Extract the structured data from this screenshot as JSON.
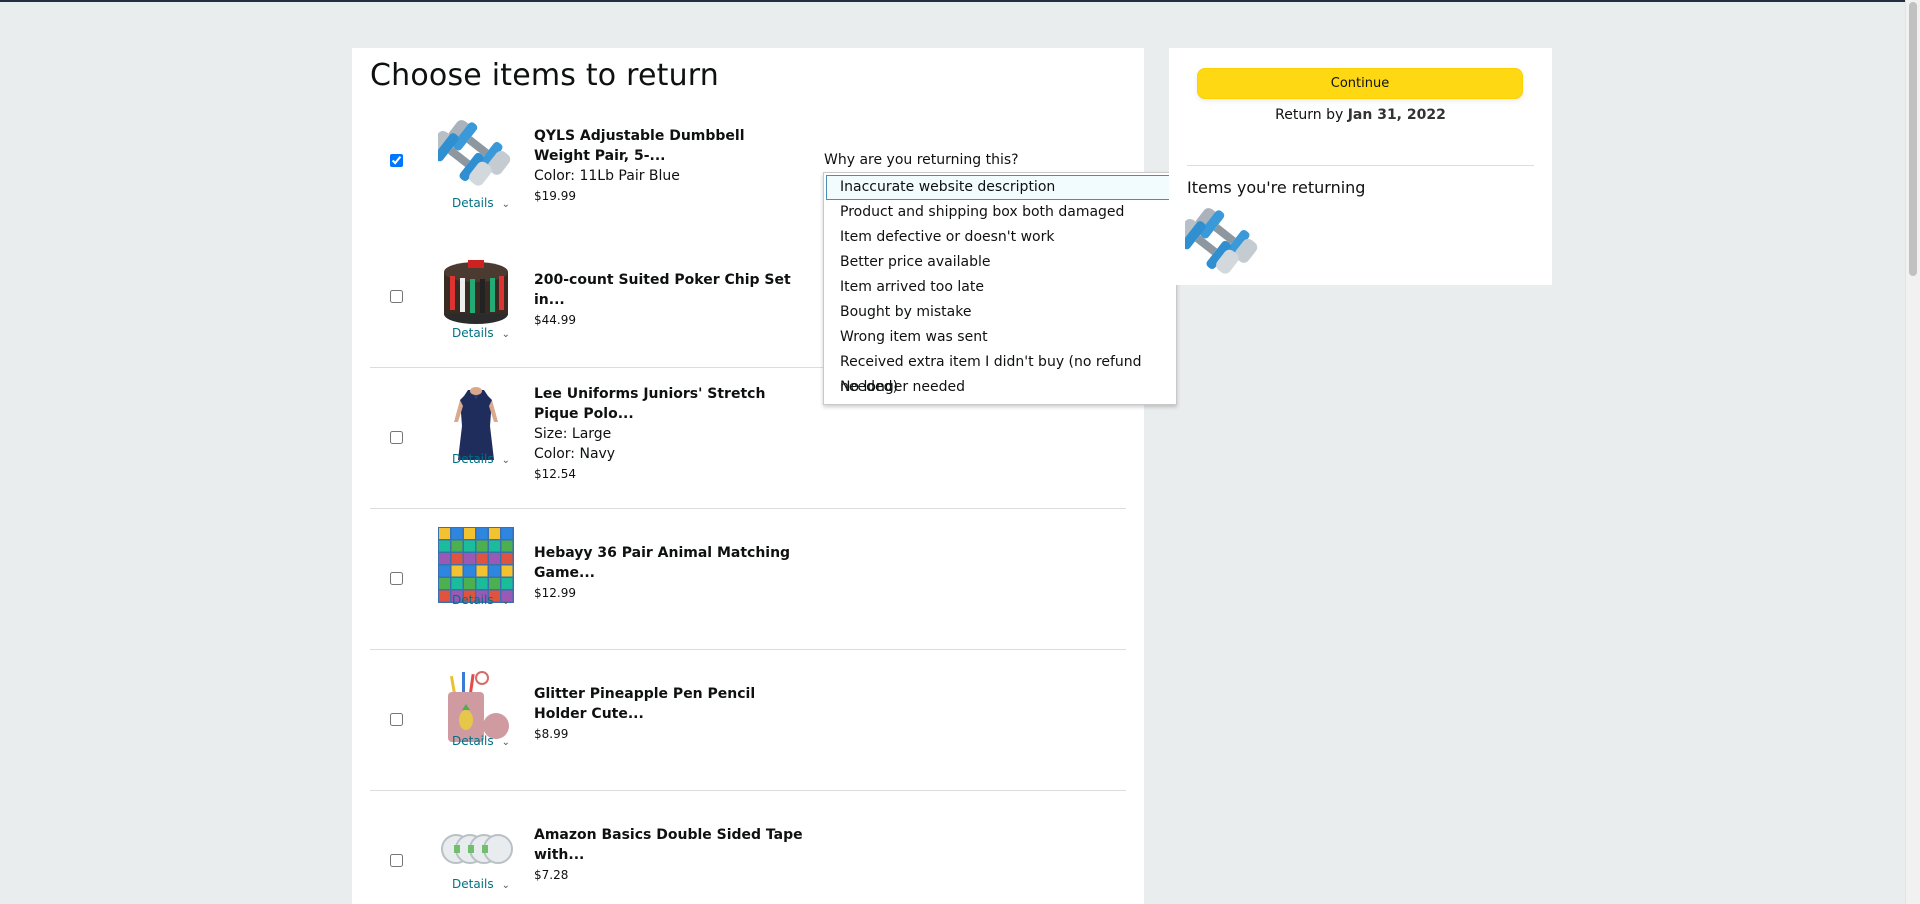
{
  "page": {
    "title": "Choose items to return"
  },
  "items": [
    {
      "name": "QYLS Adjustable Dumbbell Weight Pair, 5-...",
      "attrs": [
        "Color: 11Lb Pair Blue"
      ],
      "price": "$19.99",
      "checked": true,
      "details_label": "Details",
      "image": "dumbbell-pair-image"
    },
    {
      "name": "200-count Suited Poker Chip Set in...",
      "attrs": [],
      "price": "$44.99",
      "checked": false,
      "details_label": "Details",
      "image": "poker-chip-carousel-image"
    },
    {
      "name": "Lee Uniforms Juniors' Stretch Pique Polo...",
      "attrs": [
        "Size: Large",
        "Color: Navy"
      ],
      "price": "$12.54",
      "checked": false,
      "details_label": "Details",
      "image": "navy-polo-image"
    },
    {
      "name": "Hebayy 36 Pair Animal Matching Game...",
      "attrs": [],
      "price": "$12.99",
      "checked": false,
      "details_label": "Details",
      "image": "animal-matching-cards-image"
    },
    {
      "name": "Glitter Pineapple Pen Pencil Holder Cute...",
      "attrs": [],
      "price": "$8.99",
      "checked": false,
      "details_label": "Details",
      "image": "pineapple-pen-holder-image"
    },
    {
      "name": "Amazon Basics Double Sided Tape with...",
      "attrs": [],
      "price": "$7.28",
      "checked": false,
      "details_label": "Details",
      "image": "double-sided-tape-image"
    }
  ],
  "return_reason": {
    "label": "Why are you returning this?",
    "selected_index": 0,
    "options": [
      "Inaccurate website description",
      "Product and shipping box both damaged",
      "Item defective or doesn't work",
      "Better price available",
      "Item arrived too late",
      "Bought by mistake",
      "Wrong item was sent",
      "Received extra item I didn't buy (no refund needed)",
      "No longer needed"
    ]
  },
  "sidebar": {
    "continue_label": "Continue",
    "return_by_prefix": "Return by",
    "return_by_date": "Jan 31, 2022",
    "items_title": "Items you're returning",
    "thumb_image": "dumbbell-pair-image"
  },
  "colors": {
    "accent_button": "#ffd814",
    "link": "#007185",
    "page_bg": "#eaeded",
    "topbar": "#232f3e"
  }
}
